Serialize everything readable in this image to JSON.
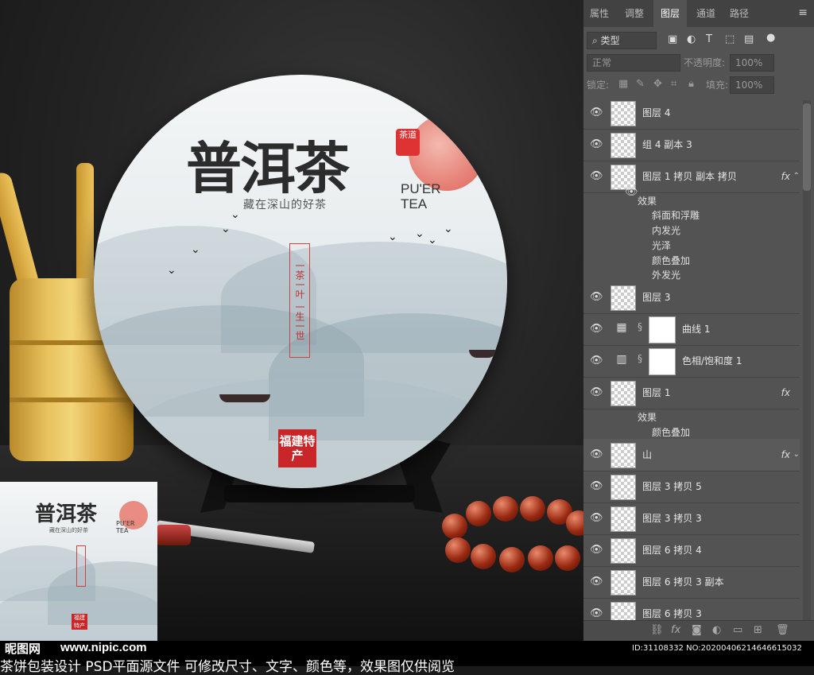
{
  "canvas": {
    "cake": {
      "title": "普洱茶",
      "pu_er": "PU'ER TEA",
      "subtitle": "藏在深山的好茶",
      "tag_seal": "茶道",
      "vertical_text": "一茶一叶 一生一世",
      "stamp": "福建特产"
    },
    "thumbnail": {
      "title": "普洱茶",
      "pu_er": "PU'ER TEA",
      "subtitle": "藏在深山的好茶",
      "stamp": "福建特产"
    }
  },
  "watermark": {
    "logo": "昵图网",
    "url": "www.nipic.com",
    "id": "ID:31108332 NO:20200406214646615032",
    "caption": "茶饼包装设计 PSD平面源文件 可修改尺寸、文字、颜色等，效果图仅供阅览"
  },
  "panel": {
    "tabs": [
      "属性",
      "调整",
      "图层",
      "通道",
      "路径"
    ],
    "active_tab": "图层",
    "menu_icon": "≡",
    "filter_kind": "类型",
    "blend_mode": "正常",
    "opacity_label": "不透明度:",
    "opacity_value": "100%",
    "lock_label": "锁定:",
    "fill_label": "填充:",
    "fill_value": "100%",
    "layers": [
      {
        "name": "图层 4",
        "fx": ""
      },
      {
        "name": "组 4 副本 3",
        "fx": ""
      },
      {
        "name": "图层 1 拷贝 副本 拷贝",
        "fx": "fx"
      },
      {
        "name": "图层 3",
        "fx": ""
      },
      {
        "name": "曲线 1",
        "fx": ""
      },
      {
        "name": "色相/饱和度 1",
        "fx": ""
      },
      {
        "name": "图层 1",
        "fx": "fx"
      },
      {
        "name": "山",
        "fx": "fx"
      },
      {
        "name": "图层 3 拷贝 5",
        "fx": ""
      },
      {
        "name": "图层 3 拷贝 3",
        "fx": ""
      },
      {
        "name": "图层 6 拷贝 4",
        "fx": ""
      },
      {
        "name": "图层 6 拷贝 3 副本",
        "fx": ""
      },
      {
        "name": "图层 6 拷贝 3",
        "fx": ""
      }
    ],
    "effects_a": {
      "header": "效果",
      "items": [
        "斜面和浮雕",
        "内发光",
        "光泽",
        "颜色叠加",
        "外发光"
      ]
    },
    "effects_b": {
      "header": "效果",
      "items": [
        "颜色叠加"
      ]
    },
    "icons": {
      "eye": "eye-icon",
      "link": "link-icon",
      "curves": "curves-icon",
      "hue": "hue-saturation-icon",
      "footer": [
        "link-layers-icon",
        "fx-icon",
        "mask-icon",
        "adjustment-icon",
        "folder-icon",
        "new-layer-icon",
        "trash-icon"
      ]
    }
  }
}
